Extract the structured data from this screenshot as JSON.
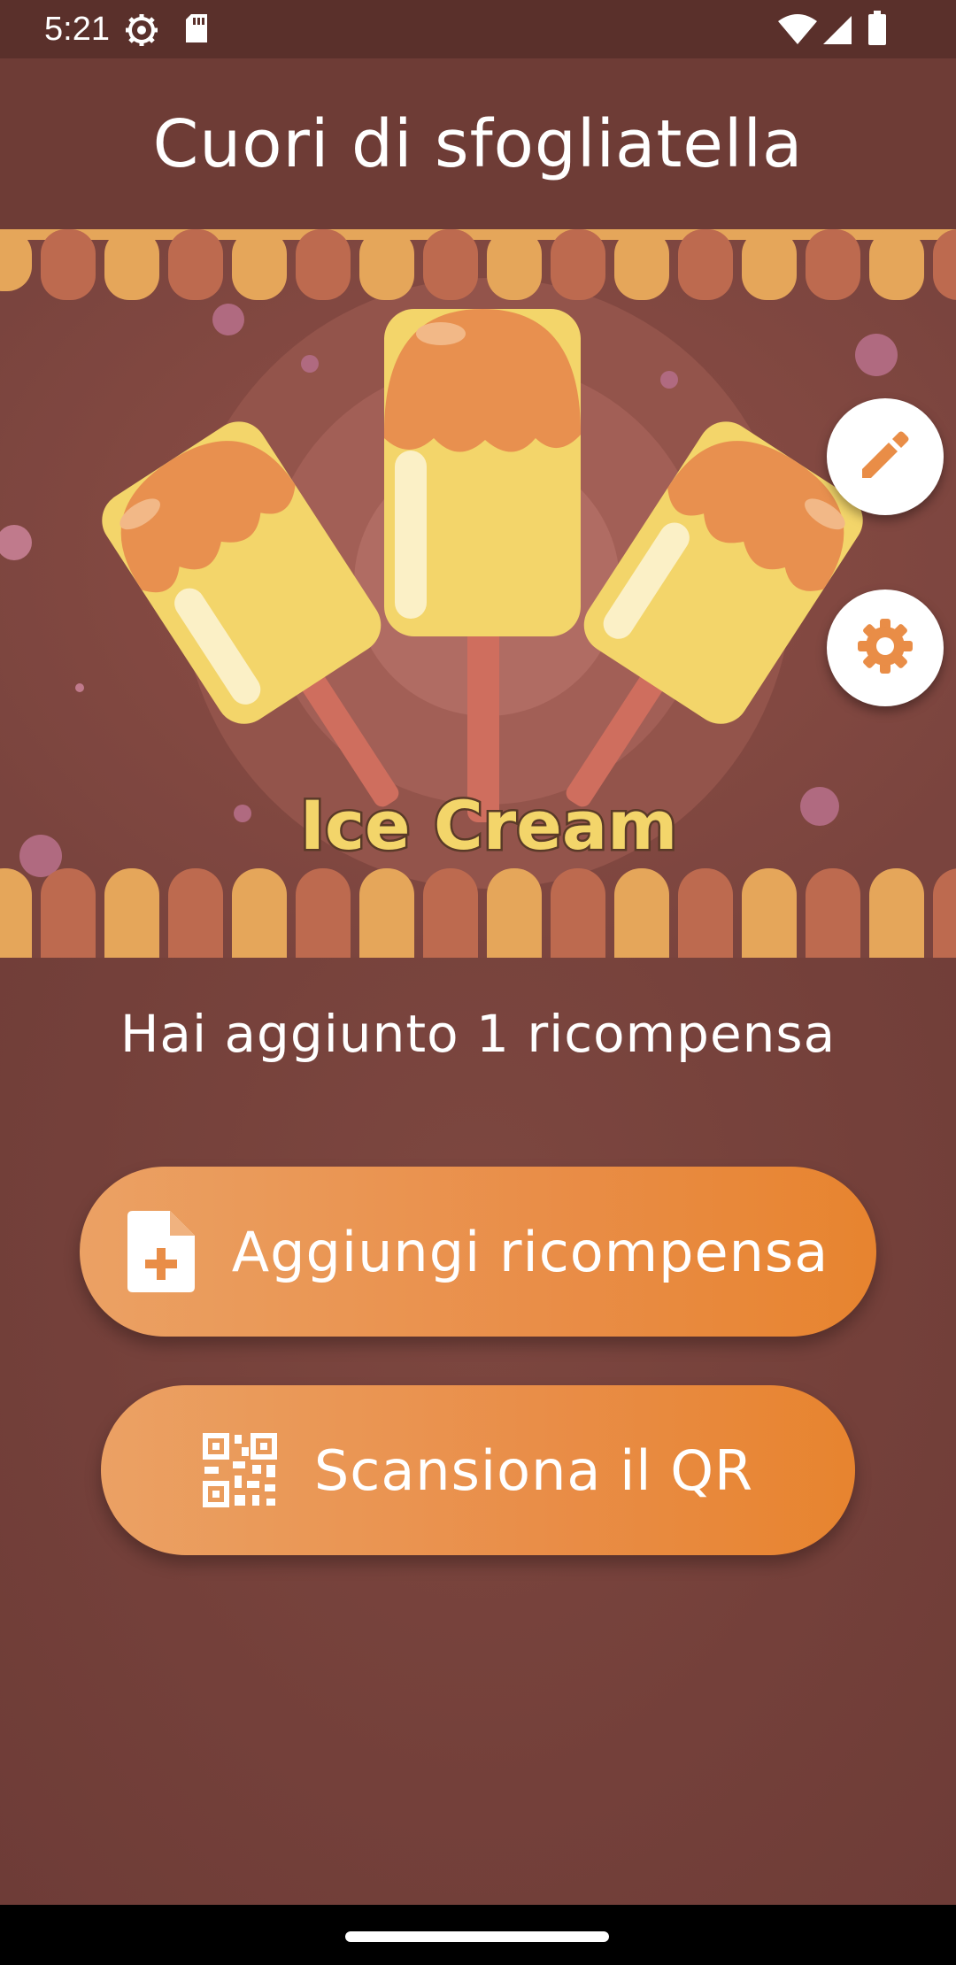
{
  "status_bar": {
    "time": "5:21",
    "icons": [
      "settings-gear-icon",
      "sd-card-icon",
      "wifi-icon",
      "signal-icon",
      "battery-icon"
    ]
  },
  "header": {
    "title": "Cuori di sfogliatella"
  },
  "banner": {
    "caption": "Ice Cream"
  },
  "fabs": {
    "edit_icon": "pencil-icon",
    "settings_icon": "gear-icon"
  },
  "main": {
    "reward_message": "Hai aggiunto 1 ricompensa",
    "add_reward_label": "Aggiungi ricompensa",
    "add_reward_icon": "file-plus-icon",
    "scan_qr_label": "Scansiona il QR",
    "scan_qr_icon": "qr-code-icon"
  },
  "colors": {
    "accent": "#e98d47",
    "background": "#7a463f",
    "header": "#6e3c36",
    "status_bar": "#5a302b"
  }
}
